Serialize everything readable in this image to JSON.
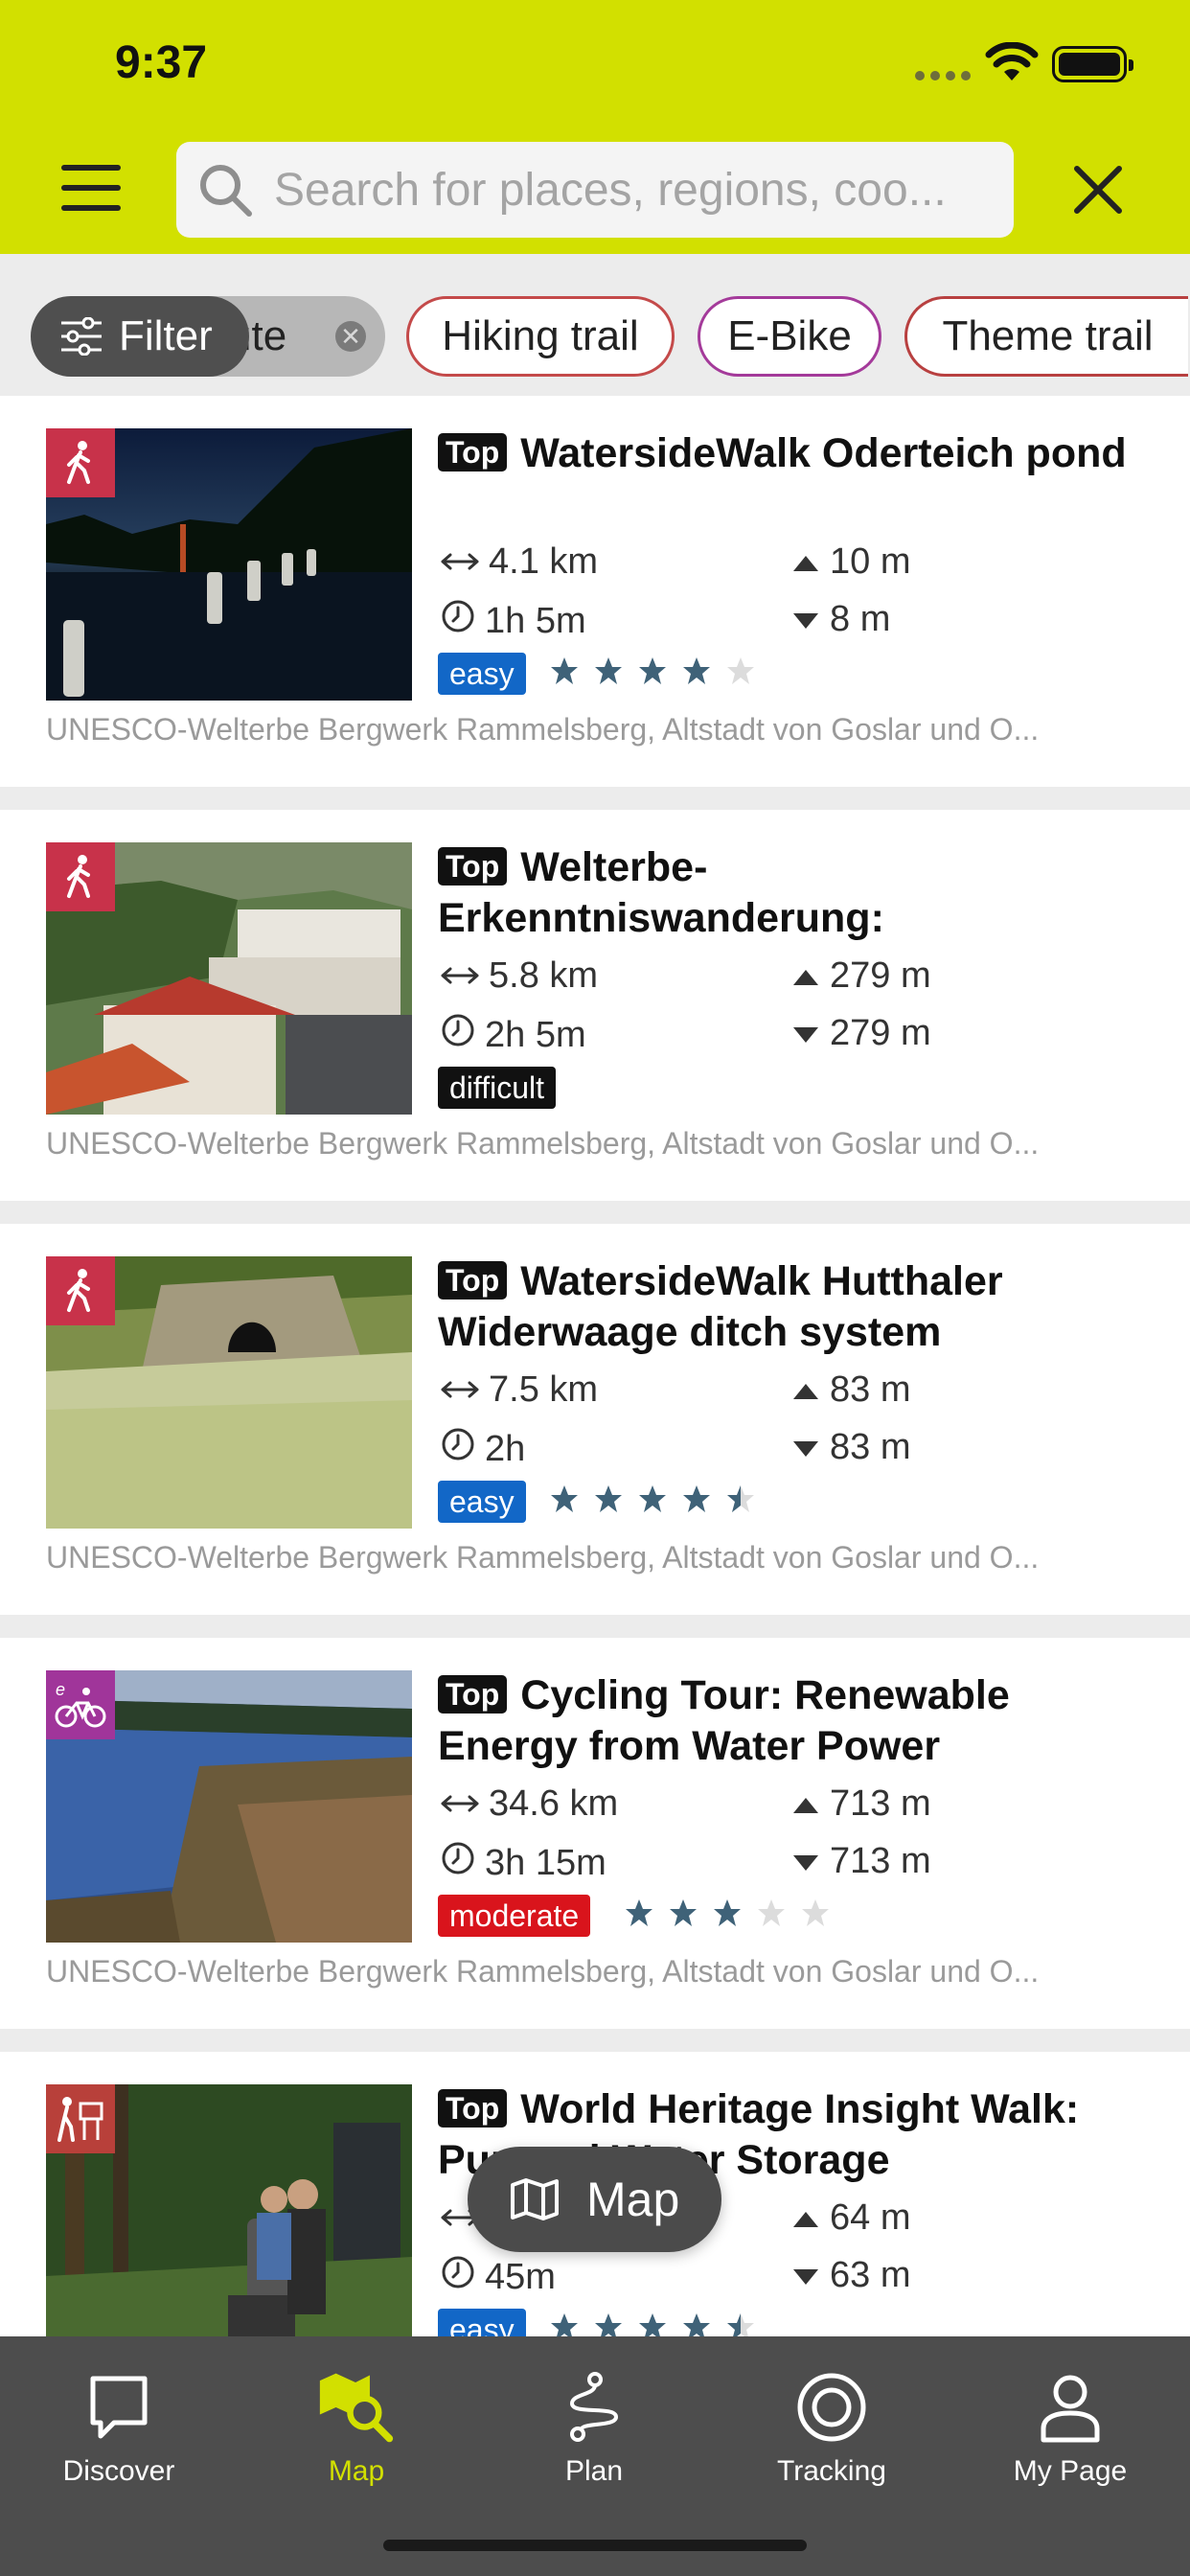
{
  "status_bar": {
    "time": "9:37"
  },
  "search": {
    "placeholder": "Search for places, regions, coo..."
  },
  "filter": {
    "button_label": "Filter",
    "active_chip_label": "ute",
    "chips": [
      {
        "label": "Hiking trail",
        "color": "#c44a4a"
      },
      {
        "label": "E-Bike",
        "color": "#a43a9a"
      },
      {
        "label": "Theme trail",
        "color": "#b84040"
      }
    ]
  },
  "tours": [
    {
      "top_label": "Top",
      "title": "WatersideWalk Oderteich pond",
      "category_icon": "hiking-icon",
      "category_color": "#c8324a",
      "distance": "4.1 km",
      "duration": "1h 5m",
      "ascent": "10 m",
      "descent": "8 m",
      "difficulty": "easy",
      "difficulty_color": "#1267c7",
      "rating": 4,
      "region": "UNESCO-Welterbe Bergwerk Rammelsberg, Altstadt von Goslar und O..."
    },
    {
      "top_label": "Top",
      "title": "Welterbe-Erkenntniswanderung:",
      "category_icon": "hiking-icon",
      "category_color": "#c8324a",
      "distance": "5.8 km",
      "duration": "2h 5m",
      "ascent": "279 m",
      "descent": "279 m",
      "difficulty": "difficult",
      "difficulty_color": "#111111",
      "rating": null,
      "region": "UNESCO-Welterbe Bergwerk Rammelsberg, Altstadt von Goslar und O..."
    },
    {
      "top_label": "Top",
      "title": "WatersideWalk Hutthaler Widerwaage ditch system",
      "category_icon": "hiking-icon",
      "category_color": "#c8324a",
      "distance": "7.5 km",
      "duration": "2h",
      "ascent": "83 m",
      "descent": "83 m",
      "difficulty": "easy",
      "difficulty_color": "#1267c7",
      "rating": 4.5,
      "region": "UNESCO-Welterbe Bergwerk Rammelsberg, Altstadt von Goslar und O..."
    },
    {
      "top_label": "Top",
      "title": "Cycling Tour: Renewable Energy from Water Power",
      "category_icon": "e-bike-icon",
      "category_color": "#a0359a",
      "distance": "34.6 km",
      "duration": "3h 15m",
      "ascent": "713 m",
      "descent": "713 m",
      "difficulty": "moderate",
      "difficulty_color": "#d9141c",
      "rating": 3,
      "region": "UNESCO-Welterbe Bergwerk Rammelsberg, Altstadt von Goslar und O..."
    },
    {
      "top_label": "Top",
      "title": "World Heritage Insight Walk: Pumped Water Storage",
      "category_icon": "theme-trail-icon",
      "category_color": "#b8403a",
      "distance": "",
      "duration": "45m",
      "ascent": "64 m",
      "descent": "63 m",
      "difficulty": "easy",
      "difficulty_color": "#1267c7",
      "rating": 4.5,
      "region": ""
    }
  ],
  "map_button": {
    "label": "Map"
  },
  "tabbar": {
    "tabs": [
      {
        "label": "Discover",
        "icon": "discover-icon",
        "active": false
      },
      {
        "label": "Map",
        "icon": "map-search-icon",
        "active": true
      },
      {
        "label": "Plan",
        "icon": "route-plan-icon",
        "active": false
      },
      {
        "label": "Tracking",
        "icon": "tracking-icon",
        "active": false
      },
      {
        "label": "My Page",
        "icon": "profile-icon",
        "active": false
      }
    ],
    "active_color": "#d2e000"
  }
}
